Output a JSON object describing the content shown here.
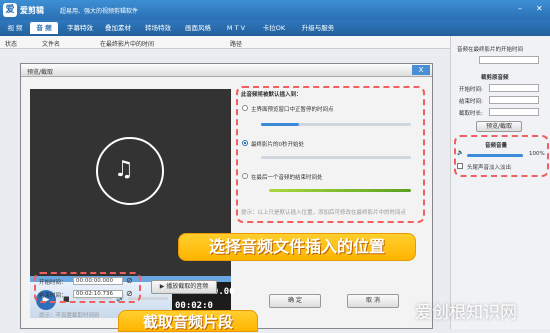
{
  "app": {
    "logo": "爱",
    "name": "爱剪辑",
    "slogan": "超易用、强大的视频剪辑软件"
  },
  "menu": [
    "视 频",
    "音 频",
    "字幕特效",
    "叠加素材",
    "转场特效",
    "画面风格",
    "M T V",
    "卡拉OK",
    "升级与服务"
  ],
  "columns": {
    "status": "状态",
    "filename": "文件名",
    "start": "在最终影片中的时间",
    "path": "路径"
  },
  "right": {
    "insert_title": "音频在最终影片的开始时间",
    "clip_title": "裁剪原音频",
    "start": "开始时间:",
    "end": "结束时间:",
    "duration": "截取时长:",
    "preview_btn": "预览/截取",
    "volume_title": "音频音量",
    "volume": "100%",
    "fade": "头尾声音淡入淡出"
  },
  "dialog": {
    "title": "预览/截取",
    "close": "X",
    "insert_heading": "此音频将被默认插入到：",
    "options": [
      "主界面预览窗口中正暂停的时间点",
      "最终影片的0秒开始处",
      "在最后一个音频的结束时间处"
    ],
    "tip": "提示：以上只是默认插入位置，添加后可修改在最终影片中的时间点",
    "time_top": "00:00:00.00",
    "time_bottom": "00:02:0",
    "cut_heading": "截取：",
    "start_label": "开始时间：",
    "start_value": "00:00:00.000",
    "end_label": "结束时间：",
    "end_value": "00:02:10.736",
    "play_btn": "播放截取的音频",
    "ok": "确 定",
    "cancel": "取 消",
    "note": "提示：不设置截取时间则"
  },
  "callouts": {
    "insert": "选择音频文件插入的位置",
    "cut": "截取音频片段"
  },
  "watermark": "爱创根知识网",
  "controls": {
    "play": "▶",
    "stop": "■"
  },
  "colors": {
    "accent": "#2a6fb3",
    "highlight": "#f06060",
    "callout": "#ffc21a"
  },
  "selected_option": 1
}
